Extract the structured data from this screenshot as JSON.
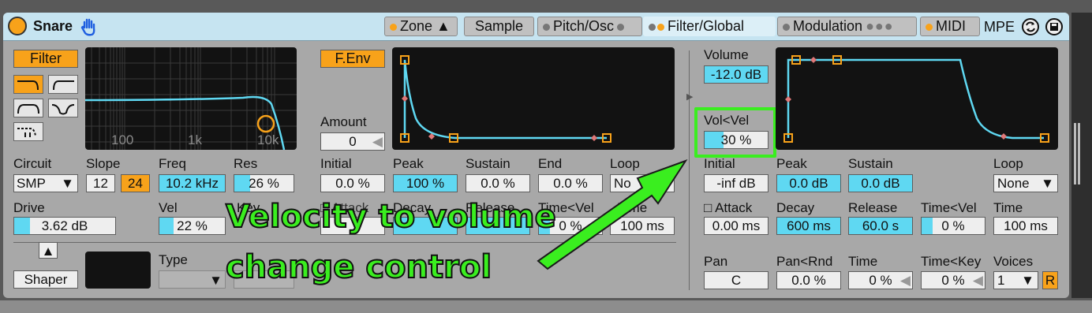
{
  "device": {
    "name": "Snare"
  },
  "tabs": {
    "zone": "Zone ▲",
    "sample": "Sample",
    "pitch": "Pitch/Osc",
    "filter": "Filter/Global",
    "modulation": "Modulation",
    "midi": "MIDI",
    "mpe": "MPE"
  },
  "filter": {
    "label": "Filter",
    "ticks": [
      "100",
      "1k",
      "10k"
    ],
    "circuit_label": "Circuit",
    "circuit_value": "SMP",
    "slope_label": "Slope",
    "slope_12": "12",
    "slope_24": "24",
    "freq_label": "Freq",
    "freq_value": "10.2 kHz",
    "res_label": "Res",
    "res_value": "26 %",
    "drive_label": "Drive",
    "drive_value": "3.62 dB",
    "vel_label": "Vel",
    "vel_value": "22 %",
    "key_label": "Key",
    "shaper_label": "Shaper",
    "type_label": "Type",
    "res_fill": 0.26,
    "vel_fill": 0.22
  },
  "fenv": {
    "label": "F.Env",
    "amount_label": "Amount",
    "amount_value": "0",
    "initial_label": "Initial",
    "initial_value": "0.0 %",
    "peak_label": "Peak",
    "peak_value": "100 %",
    "sustain_label": "Sustain",
    "sustain_value": "0.0 %",
    "end_label": "End",
    "end_value": "0.0 %",
    "loop_label": "Loop",
    "loop_value": "No",
    "attack_label": "Attack",
    "decay_label": "Decay",
    "release_label": "Release",
    "time_vel_label": "Time<Vel",
    "time_label": "Time",
    "time_value": "100 ms",
    "time_vel_value": "0 %"
  },
  "global": {
    "volume_label": "Volume",
    "volume_value": "-12.0 dB",
    "volvel_label": "Vol<Vel",
    "volvel_value": "30 %",
    "volvel_fill": 0.3,
    "initial_label": "Initial",
    "initial_value": "-inf dB",
    "peak_label": "Peak",
    "peak_value": "0.0 dB",
    "sustain_label": "Sustain",
    "sustain_value": "0.0 dB",
    "loop_label": "Loop",
    "loop_value": "None",
    "attack_label": "Attack",
    "attack_value": "0.00 ms",
    "decay_label": "Decay",
    "decay_value": "600 ms",
    "release_label": "Release",
    "release_value": "60.0 s",
    "time_vel_label": "Time<Vel",
    "time_vel_value": "0 %",
    "time_label": "Time",
    "time_value": "100 ms",
    "pan_label": "Pan",
    "pan_value": "C",
    "panrnd_label": "Pan<Rnd",
    "panrnd_value": "0.0 %",
    "ptime_label": "Time",
    "ptime_value": "0 %",
    "timekey_label": "Time<Key",
    "timekey_value": "0 %",
    "voices_label": "Voices",
    "voices_value": "1",
    "retrig": "R"
  },
  "annotation": {
    "line1": "Velocity to volume",
    "line2": "change control"
  },
  "colors": {
    "accent": "#f8a21a",
    "blue": "#5fd8f2",
    "green": "#3aee1f",
    "screen": "#121212"
  }
}
